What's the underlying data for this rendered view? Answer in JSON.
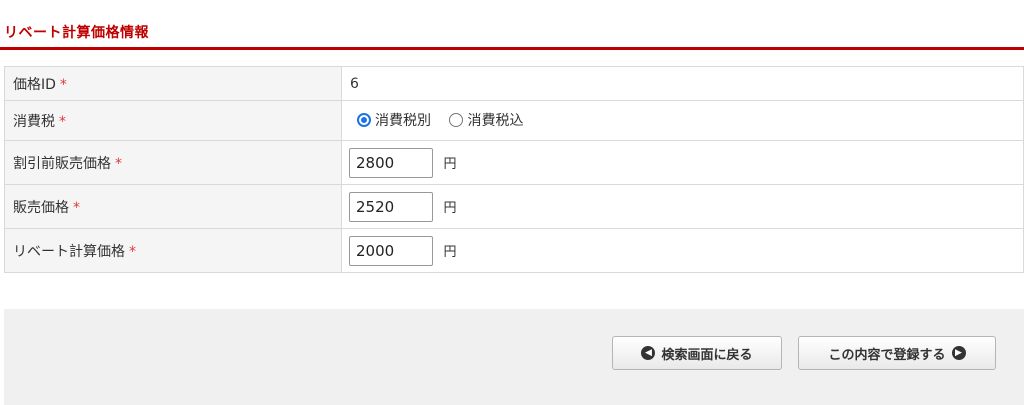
{
  "section": {
    "title": "リベート計算価格情報"
  },
  "required_mark": "*",
  "fields": {
    "price_id": {
      "label": "価格ID",
      "value": "6"
    },
    "tax": {
      "label": "消費税",
      "options": [
        "消費税別",
        "消費税込"
      ],
      "selected": "消費税別"
    },
    "pre_discount_price": {
      "label": "割引前販売価格",
      "value": "2800",
      "unit": "円"
    },
    "sales_price": {
      "label": "販売価格",
      "value": "2520",
      "unit": "円"
    },
    "rebate_price": {
      "label": "リベート計算価格",
      "value": "2000",
      "unit": "円"
    }
  },
  "buttons": {
    "back": "検索画面に戻る",
    "submit": "この内容で登録する"
  },
  "icons": {
    "back": "chevron-left-circle-icon",
    "submit": "chevron-right-circle-icon"
  },
  "colors": {
    "accent": "#c00000",
    "required": "#e03a3a",
    "radio": "#1a73e8"
  }
}
